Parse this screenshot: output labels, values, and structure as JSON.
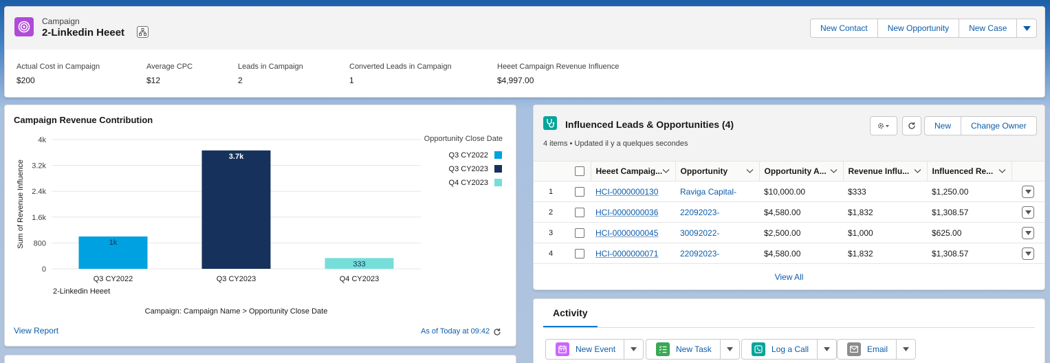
{
  "header": {
    "object_type": "Campaign",
    "record_name": "2-Linkedin Heeet",
    "actions": [
      "New Contact",
      "New Opportunity",
      "New Case"
    ],
    "fields": [
      {
        "label": "Actual Cost in Campaign",
        "value": "$200"
      },
      {
        "label": "Average CPC",
        "value": "$12"
      },
      {
        "label": "Leads in Campaign",
        "value": "2"
      },
      {
        "label": "Converted Leads in Campaign",
        "value": "1"
      },
      {
        "label": "Heeet Campaign Revenue Influence",
        "value": "$4,997.00"
      }
    ]
  },
  "chart_card": {
    "title": "Campaign Revenue Contribution",
    "view_report": "View Report",
    "as_of": "As of Today at 09:42"
  },
  "chart_data": {
    "type": "bar",
    "categories": [
      "Q3 CY2022",
      "Q3 CY2023",
      "Q4 CY2023"
    ],
    "group_label": "2-Linkedin Heeet",
    "series": [
      {
        "name": "Q3 CY2022",
        "color": "#00a1e0",
        "values": [
          1000,
          null,
          null
        ],
        "label": "1k"
      },
      {
        "name": "Q3 CY2023",
        "color": "#16325c",
        "values": [
          null,
          3664,
          null
        ],
        "label": "3.7k"
      },
      {
        "name": "Q4 CY2023",
        "color": "#76ded9",
        "values": [
          null,
          null,
          333
        ],
        "label": "333"
      }
    ],
    "ylabel": "Sum of Revenue Influence",
    "xlabel": "Campaign: Campaign Name > Opportunity Close Date",
    "legend_title": "Opportunity Close Date",
    "legend_position": "right",
    "yticks": [
      "0",
      "800",
      "1.6k",
      "2.4k",
      "3.2k",
      "4k"
    ],
    "ylim": [
      0,
      4000
    ],
    "grid": true
  },
  "leads": {
    "title": "Influenced Leads & Opportunities (4)",
    "subtitle": "4 items • Updated il y a quelques secondes",
    "buttons": [
      "New",
      "Change Owner"
    ],
    "columns": [
      "Heeet Campaig...",
      "Opportunity",
      "Opportunity A...",
      "Revenue Influ...",
      "Influenced Re..."
    ],
    "rows": [
      {
        "n": "1",
        "id": "HCI-0000000130",
        "opp": "Raviga Capital-",
        "amount": "$10,000.00",
        "rev": "$333",
        "infl": "$1,250.00"
      },
      {
        "n": "2",
        "id": "HCI-0000000036",
        "opp": "22092023-",
        "amount": "$4,580.00",
        "rev": "$1,832",
        "infl": "$1,308.57"
      },
      {
        "n": "3",
        "id": "HCI-0000000045",
        "opp": "30092022-",
        "amount": "$2,500.00",
        "rev": "$1,000",
        "infl": "$625.00"
      },
      {
        "n": "4",
        "id": "HCI-0000000071",
        "opp": "22092023-",
        "amount": "$4,580.00",
        "rev": "$1,832",
        "infl": "$1,308.57"
      }
    ],
    "view_all": "View All"
  },
  "activity": {
    "tab": "Activity",
    "buttons": [
      {
        "label": "New Event",
        "color": "#cb65ff",
        "icon": "calendar-icon"
      },
      {
        "label": "New Task",
        "color": "#3ba755",
        "icon": "task-icon"
      },
      {
        "label": "Log a Call",
        "color": "#06a59a",
        "icon": "phone-icon"
      },
      {
        "label": "Email",
        "color": "#8c8c8c",
        "icon": "email-icon"
      }
    ]
  }
}
